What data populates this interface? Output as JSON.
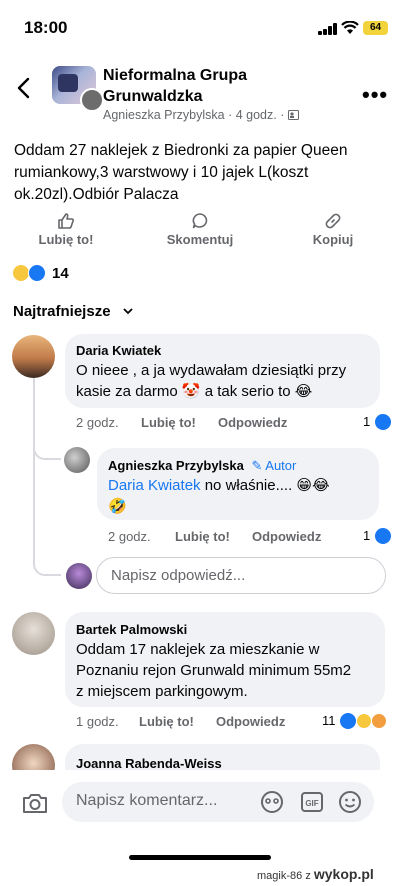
{
  "status": {
    "time": "18:00",
    "battery": "64"
  },
  "header": {
    "group_name": "Nieformalna Grupa Grunwaldzka",
    "author": "Agnieszka Przybylska",
    "time_ago": "4 godz."
  },
  "post": {
    "text": "Oddam 27 naklejek z Biedronki za papier Queen rumiankowy,3 warstwowy i 10 jajek L(koszt ok.20zl).Odbiór Palacza"
  },
  "actions": {
    "like": "Lubię to!",
    "comment": "Skomentuj",
    "copy": "Kopiuj"
  },
  "reactions": {
    "count": "14"
  },
  "sort": {
    "label": "Najtrafniejsze"
  },
  "comments": [
    {
      "author": "Daria Kwiatek",
      "text_line1": "O nieee , a ja wydawałam dziesiątki przy",
      "text_line2": "kasie za darmo 🤡 a tak serio to 😂",
      "time": "2 godz.",
      "like": "Lubię to!",
      "reply": "Odpowiedz",
      "likes": "1"
    },
    {
      "author": "Agnieszka Przybylska",
      "badge": "Autor",
      "mention": "Daria Kwiatek",
      "text_rest": " no właśnie.... 😁😂",
      "text_line2": "🤣",
      "time": "2 godz.",
      "like": "Lubię to!",
      "reply": "Odpowiedz",
      "likes": "1"
    },
    {
      "author": "Bartek Palmowski",
      "text_line1": "Oddam 17 naklejek za mieszkanie w",
      "text_line2": "Poznaniu rejon Grunwald minimum 55m2",
      "text_line3": "z miejscem parkingowym.",
      "time": "1 godz.",
      "like": "Lubię to!",
      "reply": "Odpowiedz",
      "likes": "11"
    },
    {
      "author": "Joanna Rabenda-Weiss"
    }
  ],
  "reply_placeholder": "Napisz odpowiedź...",
  "comment_placeholder": "Napisz komentarz...",
  "watermark": {
    "user": "magik-86",
    "z": "z",
    "site": "wykop.pl"
  },
  "colors": {
    "link": "#1877f2",
    "bubble": "#f0f2f5",
    "meta": "#65676b"
  }
}
